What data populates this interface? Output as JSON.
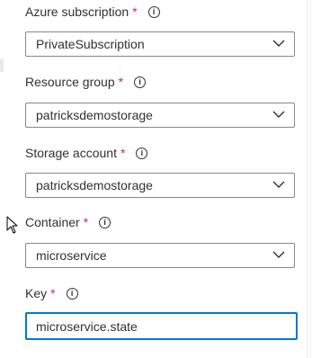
{
  "form": {
    "subscription": {
      "label": "Azure subscription",
      "required_marker": "*",
      "info_icon": "info-icon",
      "value": "PrivateSubscription"
    },
    "resource_group": {
      "label": "Resource group",
      "required_marker": "*",
      "info_icon": "info-icon",
      "value": "patricksdemostorage"
    },
    "storage_account": {
      "label": "Storage account",
      "required_marker": "*",
      "info_icon": "info-icon",
      "value": "patricksdemostorage"
    },
    "container": {
      "label": "Container",
      "required_marker": "*",
      "info_icon": "info-icon",
      "value": "microservice"
    },
    "key": {
      "label": "Key",
      "required_marker": "*",
      "info_icon": "info-icon",
      "value": "microservice.state"
    }
  },
  "colors": {
    "required": "#c4314b",
    "focus_border": "#0078d4",
    "input_border": "#8a8886",
    "text": "#323130"
  },
  "icons": {
    "dropdown": "chevron-down-icon",
    "pointer": "mouse-cursor-icon"
  }
}
